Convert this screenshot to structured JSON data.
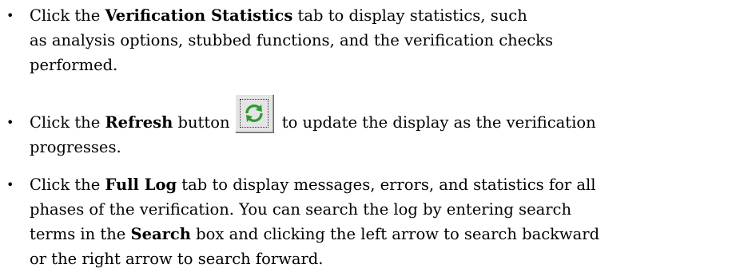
{
  "items": [
    {
      "lines": [
        {
          "pre": "Click the ",
          "bold": "Verification Statistics",
          "post": " tab to display statistics, such"
        },
        {
          "text": "as analysis options, stubbed functions, and the verification checks"
        },
        {
          "text": "performed."
        }
      ]
    },
    {
      "pre": "Click the ",
      "bold": "Refresh",
      "mid": " button",
      "post": " to update the display as the verification",
      "line2": "progresses.",
      "button_icon": "refresh-icon"
    },
    {
      "lines": [
        {
          "pre": "Click the ",
          "bold": "Full Log",
          "post": " tab to display messages, errors, and statistics for all"
        },
        {
          "text": "phases of the verification. You can search the log by entering search"
        },
        {
          "pre": "terms in the ",
          "bold": "Search",
          "post": " box and clicking the left arrow to search backward"
        },
        {
          "text": "or the right arrow to search forward."
        }
      ]
    }
  ],
  "bullet_glyph": "•"
}
